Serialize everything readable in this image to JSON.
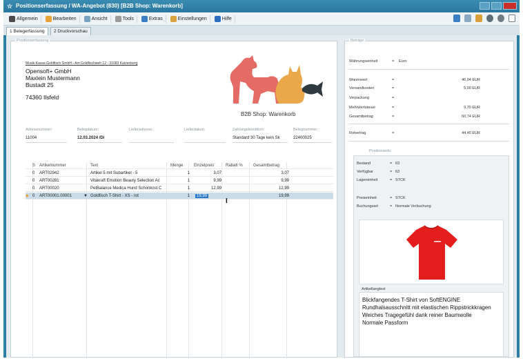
{
  "window": {
    "title": "Positionserfassung / WA-Angebot (830) [B2B Shop: Warenkorb]"
  },
  "menu": [
    {
      "label": "Allgemein",
      "icon": "pin-icon",
      "color": "#4a4a4a"
    },
    {
      "label": "Bearbeiten",
      "icon": "edit-icon",
      "color": "#e8a23a"
    },
    {
      "label": "Ansicht",
      "icon": "view-icon",
      "color": "#7aa3c2"
    },
    {
      "label": "Tools",
      "icon": "tools-icon",
      "color": "#9a9a9a"
    },
    {
      "label": "Extras",
      "icon": "extras-icon",
      "color": "#3a7fc4"
    },
    {
      "label": "Einstellungen",
      "icon": "settings-icon",
      "color": "#d9a440"
    },
    {
      "label": "Hilfe",
      "icon": "help-icon",
      "color": "#2d6fbf"
    }
  ],
  "tabs": [
    {
      "label": "1 Belegerfassung",
      "active": true
    },
    {
      "label": "2 Druckvorschau",
      "active": false
    }
  ],
  "left": {
    "group_label": "Positionserfassung",
    "address_small": "Musik-Kasse-Goldfisch GmbH - Am Goldfischweh 12 - 31683 Katzenberg",
    "address_lines": [
      "Opensoft+ GmbH",
      "Maxlein Mustermann",
      "Bustadt 25",
      "74360 Ilsfeld"
    ],
    "shop_caption": "B2B Shop: Warenkorb",
    "fields": [
      {
        "label": "Adressnummer:",
        "value": "11004"
      },
      {
        "label": "Belegdatum:",
        "value": "12.03.2024 /Di"
      },
      {
        "label": "Lieferadresse:",
        "value": ""
      },
      {
        "label": "Lieferdatum:",
        "value": ""
      },
      {
        "label": "Zahlungskondition:",
        "value": "Standard 30 Tage kein Sk"
      },
      {
        "label": "Belegnummer:",
        "value": "22400025"
      }
    ],
    "grid": {
      "headers": [
        "S",
        "Artikelnummer",
        "Text",
        "Menge",
        "Einzelpreis",
        "Rabatt %",
        "Gesamtbetrag"
      ],
      "rows": [
        {
          "s": "0",
          "nr": "ART02942",
          "text": "Artikel 5 mit Subartikel - 5",
          "menge": "1",
          "preis": "3,07",
          "rabatt": "",
          "gesamt": "3,07"
        },
        {
          "s": "0",
          "nr": "ART00281",
          "text": "Vitakraft Emotion Beauty Selection Ac",
          "menge": "1",
          "preis": "9,99",
          "rabatt": "",
          "gesamt": "9,99"
        },
        {
          "s": "0",
          "nr": "ART00020",
          "text": "PetBalance Medica Hund Schonkost C",
          "menge": "1",
          "preis": "12,99",
          "rabatt": "",
          "gesamt": "12,99"
        },
        {
          "s": "0",
          "nr": "ART00001.00001",
          "text": "Goldfisch T-Shirt - XS - rot",
          "menge": "1",
          "preis": "19,99",
          "rabatt": "",
          "gesamt": "19,99"
        }
      ]
    }
  },
  "right": {
    "group_label": "Beträge",
    "currency": {
      "label": "Währungseinheit",
      "sep": "=",
      "value": "Euro"
    },
    "amounts": [
      {
        "label": "Warenwert",
        "sep": "=",
        "value": "46,04 EUR"
      },
      {
        "label": "Versandkosten",
        "sep": "=",
        "value": "5,00 EUR"
      },
      {
        "label": "Verpackung",
        "sep": "=",
        "value": ""
      },
      {
        "label": "Mehrwertsteuer",
        "sep": "=",
        "value": "9,70 EUR"
      },
      {
        "label": "Gesamtbetrag",
        "sep": "=",
        "value": "60,74 EUR"
      }
    ],
    "rohertrag": {
      "label": "Rohertrag",
      "sep": "=",
      "value": "44,40 EUR"
    },
    "pos_group_label": "Positionsinfo",
    "stock": [
      {
        "label": "Bestand",
        "sep": "=",
        "value": "63"
      },
      {
        "label": "Verfügbar",
        "sep": "=",
        "value": "63"
      },
      {
        "label": "Lagereinheit",
        "sep": "=",
        "value": "STCK"
      }
    ],
    "price": [
      {
        "label": "Preiseinheit",
        "sep": "=",
        "value": "STCK"
      },
      {
        "label": "Buchungsart",
        "sep": "=",
        "value": "Normale Verbuchung"
      }
    ],
    "text_label": "Artikellangtext",
    "text_lines": [
      "Blickfangendes T-Shirt von SoftENGINE",
      "Rundhalsausschnitt mit elastischen Rippstrickkragen",
      "Weiches Tragegefühl dank reiner Baumwolle",
      "Normale Passform"
    ]
  },
  "colors": {
    "titlebar": "#2d7ea6",
    "dog": "#e56b66",
    "cat": "#eba84a",
    "fish": "#2f3a40",
    "shirt": "#e41d1d",
    "selection": "#c9dce7"
  }
}
